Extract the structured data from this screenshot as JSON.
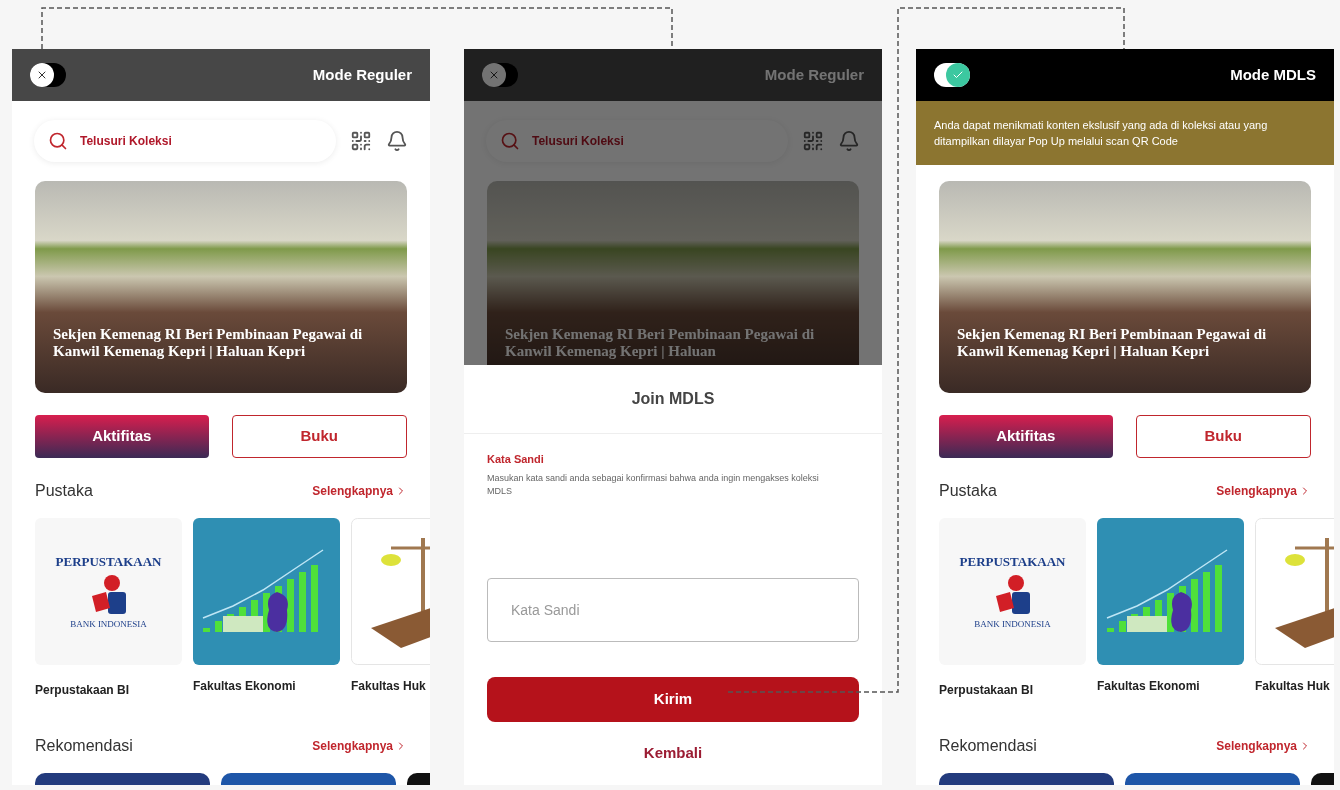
{
  "screens": [
    {
      "kind": "home",
      "toggle_on": false,
      "mode_label": "Mode Reguler",
      "search": {
        "placeholder": "Telusuri Koleksi"
      },
      "news_title": "Sekjen Kemenag RI Beri Pembinaan Pegawai di Kanwil Kemenag Kepri | Haluan Kepri",
      "tabs": [
        {
          "label": "Aktifitas",
          "selected": true
        },
        {
          "label": "Buku",
          "selected": false
        }
      ],
      "sections": [
        {
          "title": "Pustaka",
          "link": "Selengkapnya",
          "items": [
            {
              "kind": "logo",
              "logo_text": "PERPUSTAKAAN",
              "logo_subtext": "BANK INDONESIA",
              "label": "Perpustakaan BI"
            },
            {
              "kind": "finance",
              "label": "Fakultas Ekonomi"
            },
            {
              "kind": "law",
              "label": "Fakultas Huk"
            }
          ]
        },
        {
          "title": "Rekomendasi",
          "link": "Selengkapnya",
          "cards": [
            {
              "color": "#233b7d"
            },
            {
              "color": "#1e56a8"
            },
            {
              "color": "#111111"
            }
          ]
        }
      ]
    },
    {
      "kind": "dialog",
      "toggle_on": false,
      "mode_label": "Mode Reguler",
      "search": {
        "placeholder": "Telusuri Koleksi"
      },
      "news_title": "Sekjen Kemenag RI Beri Pembinaan Pegawai di Kanwil Kemenag Kepri | Haluan",
      "dialog": {
        "title": "Join MDLS",
        "field_label": "Kata Sandi",
        "hint": "Masukan kata sandi anda sebagai konfirmasi bahwa anda ingin mengakses koleksi MDLS",
        "input": {
          "placeholder": "Kata Sandi"
        },
        "submit": "Kirim",
        "back": "Kembali"
      }
    },
    {
      "kind": "home",
      "toggle_on": true,
      "mode_label": "Mode MDLS",
      "notice": "Anda dapat menikmati konten ekslusif yang ada di koleksi atau yang ditampilkan dilayar Pop Up melalui scan QR Code",
      "news_title": "Sekjen Kemenag RI Beri Pembinaan Pegawai di Kanwil Kemenag Kepri | Haluan Kepri",
      "tabs": [
        {
          "label": "Aktifitas",
          "selected": true
        },
        {
          "label": "Buku",
          "selected": false
        }
      ],
      "sections": [
        {
          "title": "Pustaka",
          "link": "Selengkapnya",
          "items": [
            {
              "kind": "logo",
              "logo_text": "PERPUSTAKAAN",
              "logo_subtext": "BANK INDONESIA",
              "label": "Perpustakaan BI"
            },
            {
              "kind": "finance",
              "label": "Fakultas Ekonomi"
            },
            {
              "kind": "law",
              "label": "Fakultas Huk"
            }
          ]
        },
        {
          "title": "Rekomendasi",
          "link": "Selengkapnya",
          "cards": [
            {
              "color": "#233b7d"
            },
            {
              "color": "#1e56a8"
            },
            {
              "color": "#111111"
            }
          ]
        }
      ]
    }
  ]
}
